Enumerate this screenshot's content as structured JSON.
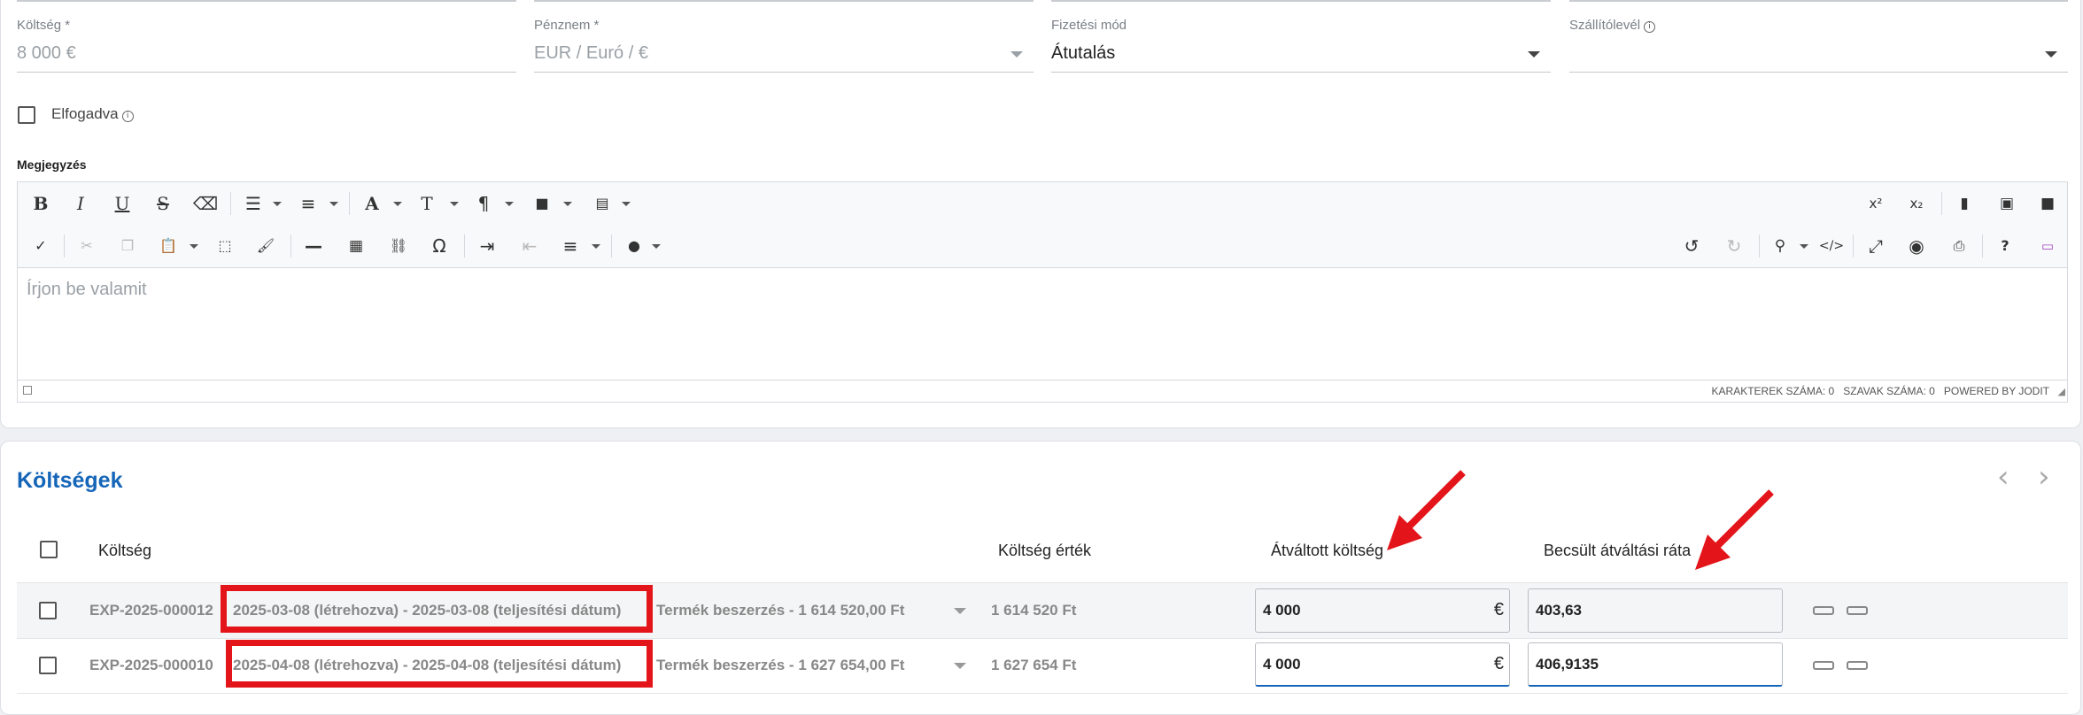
{
  "form": {
    "koltseg": {
      "label": "Költség *",
      "value": "8 000 €"
    },
    "penznem": {
      "label": "Pénznem *",
      "value": "EUR / Euró / €"
    },
    "fizetesi_mod": {
      "label": "Fizetési mód",
      "value": "Átutalás"
    },
    "szallitolevel": {
      "label": "Szállítólevél",
      "value": ""
    },
    "elfogadva_label": "Elfogadva",
    "info_glyph": "i",
    "megjegyzes_label": "Megjegyzés"
  },
  "editor": {
    "placeholder": "Írjon be valamit",
    "char_count": "KARAKTEREK SZÁMA: 0",
    "word_count": "SZAVAK SZÁMA: 0",
    "powered": "POWERED BY JODIT",
    "toolbar_row1": [
      "bold-icon",
      "italic-icon",
      "underline-icon",
      "strikethrough-icon",
      "eraser-icon",
      "list-ul-icon",
      "list-ol-icon",
      "font-icon",
      "font-size-icon",
      "paragraph-icon",
      "classes-icon",
      "spacing-icon"
    ],
    "toolbar_row2": [
      "spellcheck-icon",
      "cut-icon",
      "copy-icon",
      "paste-icon",
      "select-all-icon",
      "format-painter-icon",
      "hr-icon",
      "table-icon",
      "link-icon",
      "omega-icon",
      "indent-icon",
      "outdent-icon",
      "align-icon",
      "color-icon"
    ],
    "toolbar_right1": [
      "superscript-icon",
      "subscript-icon",
      "file-icon",
      "image-icon",
      "video-icon"
    ],
    "toolbar_right2": [
      "undo-icon",
      "redo-icon",
      "search-icon",
      "source-icon",
      "fullsize-icon",
      "preview-icon",
      "print-icon",
      "help-icon",
      "speech-icon"
    ],
    "glyphs": {
      "superscript": "x²",
      "subscript": "x₂",
      "help": "?",
      "omega": "Ω"
    }
  },
  "costs": {
    "title": "Költségek",
    "columns": {
      "koltseg": "Költség",
      "ertek": "Költség érték",
      "atvaltott": "Átváltott költség",
      "rata": "Becsült átváltási ráta"
    },
    "rows": [
      {
        "id": "EXP-2025-000012",
        "dates": "2025-03-08 (létrehozva) - 2025-03-08 (teljesítési dátum)",
        "desc": "Termék beszerzés - 1 614 520,00 Ft",
        "value": "1 614 520 Ft",
        "converted": "4 000",
        "currency": "€",
        "rate": "403,63"
      },
      {
        "id": "EXP-2025-000010",
        "dates": "2025-04-08 (létrehozva) - 2025-04-08 (teljesítési dátum)",
        "desc": "Termék beszerzés - 1 627 654,00 Ft",
        "value": "1 627 654 Ft",
        "converted": "4 000",
        "currency": "€",
        "rate": "406,9135"
      }
    ]
  },
  "colors": {
    "accent": "#1565b8",
    "annotation": "#e3151a"
  }
}
